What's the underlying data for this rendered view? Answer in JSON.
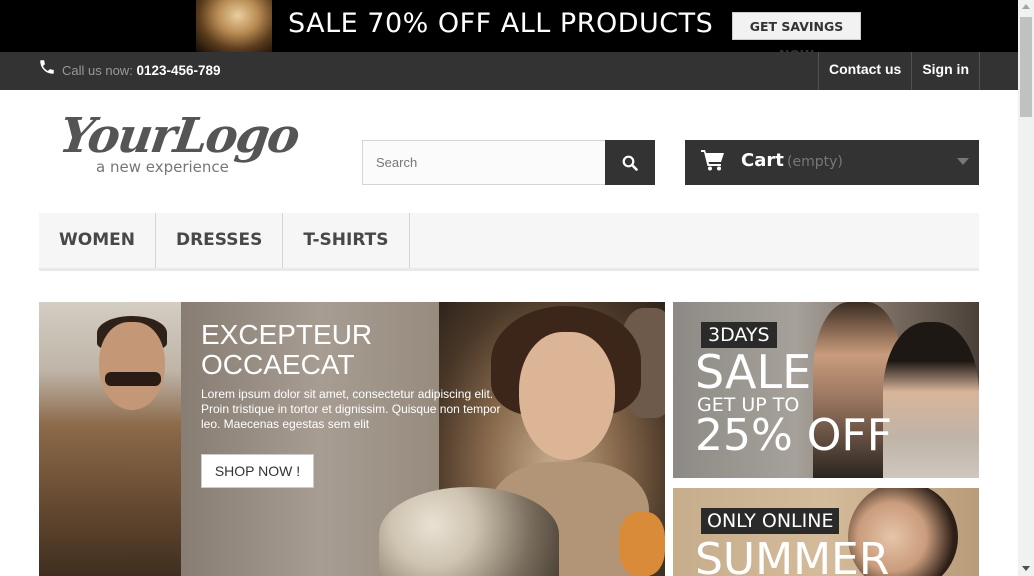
{
  "promo": {
    "title": "SALE 70% OFF ALL PRODUCTS",
    "button_label": "GET SAVINGS NOW"
  },
  "navbar": {
    "call_label": "Call us now:",
    "phone_number": "0123-456-789",
    "contact_label": "Contact us",
    "signin_label": "Sign in"
  },
  "header": {
    "logo_main": "YourLogo",
    "logo_sub": "a new experience",
    "search": {
      "placeholder": "Search",
      "value": ""
    },
    "cart": {
      "label": "Cart",
      "status": "(empty)"
    }
  },
  "menu": {
    "items": [
      {
        "label": "Women"
      },
      {
        "label": "Dresses"
      },
      {
        "label": "T-shirts"
      }
    ]
  },
  "slider": {
    "title": "EXCEPTEUR OCCAECAT",
    "text": "Lorem ipsum dolor sit amet, consectetur adipiscing elit. Proin tristique in tortor et dignissim. Quisque non tempor leo. Maecenas egestas sem elit",
    "button_label": "SHOP NOW !"
  },
  "banners": {
    "first": {
      "tag": "3DAYS",
      "headline": "SALE",
      "subline": "GET UP TO",
      "offer": "25% OFF"
    },
    "second": {
      "tag": "ONLY ONLINE",
      "headline": "SUMMER"
    }
  },
  "colors": {
    "dark_bar": "#333333",
    "promo_bg": "#000000",
    "menu_bg": "#f6f6f6",
    "text_muted": "#777777"
  }
}
